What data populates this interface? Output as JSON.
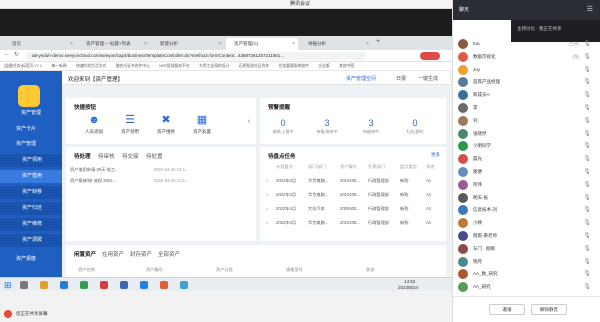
{
  "window_title": "腾讯会议",
  "browser": {
    "tabs": [
      {
        "label": "首页"
      },
      {
        "label": "资产管理----标题+列表"
      },
      {
        "label": "新建分析"
      },
      {
        "label": "资产管理(C)",
        "active": true
      },
      {
        "label": "待报分析"
      }
    ],
    "url": "a8-yeduh-demo.seeyoncloud.com/seeyon/cap4/businessTemplateController.do?method=formContent...43687261257211661...",
    "bookmarks": [
      "(监督任务)标签页 V7.1",
      "每一新闻",
      "快速时尚生活方式",
      "融合与证书合作中心",
      "NFE智慧服务平台",
      "大师工业网的设计",
      "石桥智慧社区合作",
      "任务管理系统软件",
      "企业版",
      "其他书签"
    ]
  },
  "sidebar": {
    "app_title": "资产管理",
    "items": [
      {
        "label": "资产卡片"
      },
      {
        "label": "资产管理"
      },
      {
        "label": "资产领用"
      },
      {
        "label": "资产借用"
      },
      {
        "label": "资产转移"
      },
      {
        "label": "资产归还"
      },
      {
        "label": "资产维修"
      },
      {
        "label": "资产调拨"
      },
      {
        "label": "资产报废"
      }
    ]
  },
  "main": {
    "welcome": "欢迎来到【资产管理】",
    "header_right": [
      "资产管理空间",
      "日报",
      "一键生成"
    ],
    "quick": {
      "title": "快捷按钮",
      "items": [
        {
          "icon": "users-icon",
          "label": "人员添加"
        },
        {
          "icon": "list-icon",
          "label": "资产领用"
        },
        {
          "icon": "tools-icon",
          "label": "资产维修"
        },
        {
          "icon": "chart-icon",
          "label": "资产处置"
        }
      ]
    },
    "alert": {
      "title": "预警提醒",
      "stats": [
        {
          "value": "0",
          "label": "维修/上报中"
        },
        {
          "value": "3",
          "label": "待报/保修中"
        },
        {
          "value": "3",
          "label": "待维修中"
        },
        {
          "value": "0",
          "label": "归还/超时"
        }
      ]
    },
    "todo": {
      "tabs": [
        "待处理",
        "待审核",
        "待交接",
        "待处置"
      ],
      "rows": [
        {
          "text": "资产借用申请-30天-张三...",
          "date": "2022-04-20 13:4..."
        },
        {
          "text": "资产报修/修-流程-2022...",
          "date": "2022-04-20 11:0..."
        }
      ]
    },
    "inventory": {
      "title": "待盘点任务",
      "more": "更多",
      "headers": [
        "计划盘点",
        "部门/部门",
        "资产编号",
        "负责部门",
        "盘点类型",
        "状态"
      ],
      "rows": [
        {
          "c1": "2022年4月",
          "c2": "华为电脑...",
          "c3": "2010105...",
          "c4": "行政管理部",
          "c5": "新购",
          "c6": "A1"
        },
        {
          "c1": "2022年4月",
          "c2": "华为电脑...",
          "c3": "2010105...",
          "c4": "行政管理部",
          "c5": "新购",
          "c6": "A1"
        },
        {
          "c1": "2022年4月",
          "c2": "大众汽车",
          "c3": "2000400...",
          "c4": "行政管理部",
          "c5": "新购",
          "c6": "A1"
        },
        {
          "c1": "2022年4月",
          "c2": "华为电脑...",
          "c3": "2010105...",
          "c4": "行政管理部",
          "c5": "新购",
          "c6": "A1"
        }
      ]
    },
    "bottom_tabs": [
      "闲置资产",
      "在用资产",
      "封存资产",
      "全部资产"
    ],
    "bottom_headers": [
      "资产名称",
      "资产编号",
      "资产分类",
      "规格型号",
      "状态"
    ]
  },
  "taskbar": {
    "time": "14:52",
    "date": "2023/8/24"
  },
  "recording_label": "您正在共享屏幕",
  "chat": {
    "header_tab": "聊天",
    "topic": "主持讨论 · 我正在共享",
    "members": [
      {
        "name": "Kai",
        "tag": "(主持)",
        "color": "#8a5a3c"
      },
      {
        "name": "数据可视化",
        "tag": "(我)",
        "color": "#e05a4a"
      },
      {
        "name": "Joy",
        "tag": "",
        "color": "#f0a030"
      },
      {
        "name": "首席产品经理",
        "tag": "",
        "color": "#5a7a9a"
      },
      {
        "name": "新成员A",
        "tag": "",
        "color": "#3c6e9a"
      },
      {
        "name": "李",
        "tag": "",
        "color": "#6a6a6a"
      },
      {
        "name": "刘",
        "tag": "",
        "color": "#9a7a5a"
      },
      {
        "name": "张晓然",
        "tag": "",
        "color": "#4a8a6a"
      },
      {
        "name": "小明同学",
        "tag": "",
        "color": "#2a9a4a"
      },
      {
        "name": "晨光",
        "tag": "",
        "color": "#d05050"
      },
      {
        "name": "随便",
        "tag": "",
        "color": "#6a8aba"
      },
      {
        "name": "阿伟",
        "tag": "",
        "color": "#9a5a9a"
      },
      {
        "name": "明天-张",
        "tag": "",
        "color": "#5a5a5a"
      },
      {
        "name": "信息技术-刘",
        "tag": "",
        "color": "#3a7aba"
      },
      {
        "name": "小顾",
        "tag": "",
        "color": "#ba7a3a"
      },
      {
        "name": "晓雨-黄老师",
        "tag": "",
        "color": "#4a4a8a"
      },
      {
        "name": "东门 · 刚刚",
        "tag": "",
        "color": "#8a4a4a"
      },
      {
        "name": "晓月",
        "tag": "",
        "color": "#4a8a8a"
      },
      {
        "name": "AA_数_研究",
        "tag": "",
        "color": "#aa5a2a"
      },
      {
        "name": "AA_研究",
        "tag": "",
        "color": "#5a9a5a"
      }
    ],
    "btn_invite": "邀请",
    "btn_mute": "解除静音"
  }
}
